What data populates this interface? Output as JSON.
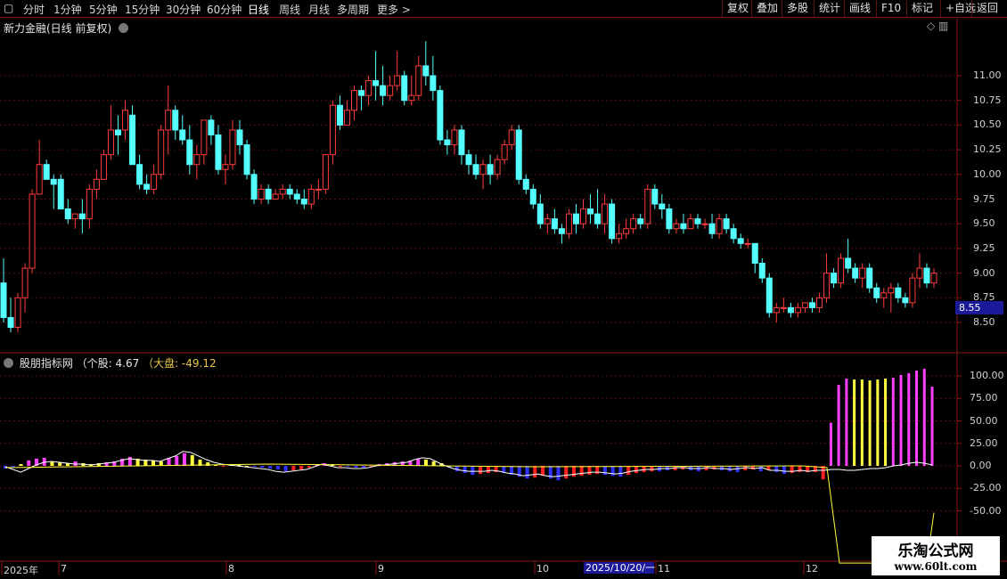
{
  "toolbar": {
    "periods": [
      "分时",
      "1分钟",
      "5分钟",
      "15分钟",
      "30分钟",
      "60分钟",
      "日线",
      "周线",
      "月线",
      "多周期",
      "更多 >"
    ],
    "active": "日线",
    "right": [
      "复权",
      "叠加",
      "多股",
      "统计",
      "画线",
      "F10",
      "标记",
      "+自选",
      "返回"
    ]
  },
  "main": {
    "title": "新力金融(日线 前复权)",
    "last_price": "8.55",
    "yticks": [
      "11.00",
      "10.75",
      "10.50",
      "10.25",
      "10.00",
      "9.75",
      "9.50",
      "9.25",
      "9.00",
      "8.75",
      "8.50"
    ]
  },
  "indicator": {
    "name": "股朋指标网",
    "stock_label": "（个股: 4.67",
    "market_label": "（大盘: -49.12",
    "yticks": [
      "100.00",
      "75.00",
      "50.00",
      "25.00",
      "0.00",
      "-25.00",
      "-50.00"
    ]
  },
  "xaxis": {
    "labels": [
      "2025年",
      "7",
      "8",
      "9",
      "10",
      "11",
      "12"
    ],
    "cursor_date": "2025/10/20/一"
  },
  "watermark": {
    "line1": "乐淘公式网",
    "line2": "www.60lt.com"
  },
  "colors": {
    "up": "#ff3c3c",
    "down": "#54ffff",
    "magenta": "#ff40ff",
    "yellow": "#ffff40",
    "blue": "#3030ff",
    "red": "#ff2020"
  },
  "chart_data": [
    {
      "type": "candlestick",
      "title": "新力金融(日线 前复权)",
      "ylim": [
        8.4,
        11.3
      ],
      "ohlc": [
        [
          8.9,
          9.15,
          8.5,
          8.55
        ],
        [
          8.55,
          8.75,
          8.4,
          8.45
        ],
        [
          8.45,
          8.8,
          8.4,
          8.75
        ],
        [
          8.75,
          9.1,
          8.6,
          9.05
        ],
        [
          9.05,
          9.85,
          9.0,
          9.8
        ],
        [
          9.8,
          10.35,
          9.8,
          10.1
        ],
        [
          10.1,
          10.15,
          9.95,
          9.95
        ],
        [
          9.95,
          10.0,
          9.65,
          9.9
        ],
        [
          9.95,
          10.0,
          9.65,
          9.65
        ],
        [
          9.65,
          9.75,
          9.5,
          9.55
        ],
        [
          9.55,
          9.6,
          9.45,
          9.6
        ],
        [
          9.6,
          9.75,
          9.4,
          9.55
        ],
        [
          9.55,
          9.9,
          9.45,
          9.85
        ],
        [
          9.85,
          10.05,
          9.75,
          9.95
        ],
        [
          9.95,
          10.25,
          9.95,
          10.2
        ],
        [
          10.2,
          10.7,
          10.15,
          10.45
        ],
        [
          10.45,
          10.6,
          10.2,
          10.4
        ],
        [
          10.45,
          10.75,
          10.35,
          10.65
        ],
        [
          10.6,
          10.7,
          10.1,
          10.1
        ],
        [
          10.1,
          10.2,
          9.85,
          9.9
        ],
        [
          9.9,
          10.0,
          9.8,
          9.85
        ],
        [
          9.85,
          10.1,
          9.8,
          10.0
        ],
        [
          10.0,
          10.5,
          9.95,
          10.45
        ],
        [
          10.45,
          10.9,
          10.2,
          10.65
        ],
        [
          10.65,
          10.7,
          10.35,
          10.45
        ],
        [
          10.45,
          10.6,
          10.3,
          10.35
        ],
        [
          10.35,
          10.5,
          10.0,
          10.1
        ],
        [
          10.1,
          10.3,
          9.95,
          10.2
        ],
        [
          10.2,
          10.55,
          10.1,
          10.55
        ],
        [
          10.55,
          10.6,
          10.3,
          10.4
        ],
        [
          10.4,
          10.5,
          10.0,
          10.05
        ],
        [
          10.05,
          10.2,
          9.9,
          10.1
        ],
        [
          10.1,
          10.55,
          10.05,
          10.45
        ],
        [
          10.45,
          10.55,
          10.2,
          10.3
        ],
        [
          10.3,
          10.35,
          9.95,
          10.0
        ],
        [
          10.0,
          10.05,
          9.7,
          9.75
        ],
        [
          9.75,
          9.9,
          9.7,
          9.85
        ],
        [
          9.85,
          9.9,
          9.7,
          9.75
        ],
        [
          9.75,
          9.85,
          9.75,
          9.8
        ],
        [
          9.8,
          9.9,
          9.75,
          9.85
        ],
        [
          9.85,
          9.9,
          9.75,
          9.8
        ],
        [
          9.8,
          9.85,
          9.7,
          9.75
        ],
        [
          9.75,
          9.85,
          9.65,
          9.7
        ],
        [
          9.7,
          9.9,
          9.65,
          9.85
        ],
        [
          9.85,
          9.95,
          9.75,
          9.85
        ],
        [
          9.85,
          10.2,
          9.8,
          10.2
        ],
        [
          10.2,
          10.75,
          10.1,
          10.7
        ],
        [
          10.7,
          10.8,
          10.45,
          10.5
        ],
        [
          10.5,
          10.75,
          10.5,
          10.65
        ],
        [
          10.65,
          10.9,
          10.55,
          10.85
        ],
        [
          10.85,
          10.9,
          10.65,
          10.8
        ],
        [
          10.8,
          11.0,
          10.7,
          10.95
        ],
        [
          10.95,
          11.25,
          10.75,
          10.9
        ],
        [
          10.9,
          11.1,
          10.7,
          10.8
        ],
        [
          10.8,
          11.0,
          10.75,
          10.9
        ],
        [
          10.9,
          11.25,
          10.85,
          11.0
        ],
        [
          11.0,
          11.05,
          10.7,
          10.75
        ],
        [
          10.75,
          11.0,
          10.7,
          10.8
        ],
        [
          10.8,
          11.2,
          10.75,
          11.1
        ],
        [
          11.1,
          11.35,
          10.9,
          11.0
        ],
        [
          11.0,
          11.2,
          10.75,
          10.85
        ],
        [
          10.85,
          10.9,
          10.3,
          10.35
        ],
        [
          10.35,
          10.45,
          10.2,
          10.3
        ],
        [
          10.3,
          10.5,
          10.2,
          10.45
        ],
        [
          10.45,
          10.5,
          10.1,
          10.2
        ],
        [
          10.2,
          10.25,
          10.0,
          10.1
        ],
        [
          10.1,
          10.2,
          9.95,
          10.0
        ],
        [
          10.0,
          10.15,
          9.85,
          10.1
        ],
        [
          10.1,
          10.2,
          9.9,
          10.0
        ],
        [
          10.0,
          10.2,
          9.95,
          10.15
        ],
        [
          10.15,
          10.35,
          10.1,
          10.3
        ],
        [
          10.3,
          10.5,
          10.25,
          10.45
        ],
        [
          10.45,
          10.5,
          9.9,
          9.95
        ],
        [
          9.95,
          10.0,
          9.8,
          9.85
        ],
        [
          9.85,
          9.9,
          9.65,
          9.7
        ],
        [
          9.7,
          9.8,
          9.45,
          9.5
        ],
        [
          9.5,
          9.6,
          9.4,
          9.55
        ],
        [
          9.55,
          9.65,
          9.4,
          9.45
        ],
        [
          9.45,
          9.5,
          9.3,
          9.4
        ],
        [
          9.4,
          9.65,
          9.35,
          9.6
        ],
        [
          9.6,
          9.7,
          9.4,
          9.5
        ],
        [
          9.5,
          9.75,
          9.45,
          9.65
        ],
        [
          9.65,
          9.8,
          9.5,
          9.6
        ],
        [
          9.6,
          9.85,
          9.45,
          9.5
        ],
        [
          9.5,
          9.8,
          9.4,
          9.7
        ],
        [
          9.7,
          9.75,
          9.3,
          9.35
        ],
        [
          9.35,
          9.5,
          9.3,
          9.4
        ],
        [
          9.4,
          9.55,
          9.35,
          9.45
        ],
        [
          9.45,
          9.6,
          9.4,
          9.55
        ],
        [
          9.55,
          9.6,
          9.45,
          9.5
        ],
        [
          9.5,
          9.9,
          9.45,
          9.85
        ],
        [
          9.85,
          9.9,
          9.65,
          9.7
        ],
        [
          9.7,
          9.8,
          9.55,
          9.65
        ],
        [
          9.65,
          9.7,
          9.4,
          9.45
        ],
        [
          9.45,
          9.55,
          9.4,
          9.5
        ],
        [
          9.5,
          9.6,
          9.4,
          9.45
        ],
        [
          9.45,
          9.6,
          9.45,
          9.55
        ],
        [
          9.55,
          9.6,
          9.45,
          9.5
        ],
        [
          9.5,
          9.55,
          9.45,
          9.5
        ],
        [
          9.5,
          9.6,
          9.35,
          9.4
        ],
        [
          9.4,
          9.6,
          9.35,
          9.55
        ],
        [
          9.55,
          9.6,
          9.4,
          9.45
        ],
        [
          9.45,
          9.5,
          9.3,
          9.35
        ],
        [
          9.35,
          9.4,
          9.25,
          9.3
        ],
        [
          9.3,
          9.35,
          9.25,
          9.3
        ],
        [
          9.3,
          9.3,
          9.0,
          9.1
        ],
        [
          9.1,
          9.15,
          8.9,
          8.95
        ],
        [
          8.95,
          9.0,
          8.55,
          8.6
        ],
        [
          8.6,
          8.7,
          8.5,
          8.65
        ],
        [
          8.65,
          8.75,
          8.6,
          8.65
        ],
        [
          8.65,
          8.7,
          8.55,
          8.6
        ],
        [
          8.6,
          8.7,
          8.55,
          8.65
        ],
        [
          8.65,
          8.7,
          8.6,
          8.7
        ],
        [
          8.7,
          8.75,
          8.6,
          8.65
        ],
        [
          8.65,
          8.8,
          8.6,
          8.75
        ],
        [
          8.75,
          9.2,
          8.7,
          9.0
        ],
        [
          9.0,
          9.05,
          8.85,
          8.9
        ],
        [
          8.9,
          9.2,
          8.85,
          9.15
        ],
        [
          9.15,
          9.35,
          9.0,
          9.05
        ],
        [
          9.05,
          9.1,
          8.9,
          8.95
        ],
        [
          8.95,
          9.1,
          8.85,
          9.05
        ],
        [
          9.05,
          9.1,
          8.8,
          8.85
        ],
        [
          8.85,
          8.9,
          8.7,
          8.75
        ],
        [
          8.75,
          8.85,
          8.65,
          8.8
        ],
        [
          8.8,
          8.9,
          8.6,
          8.85
        ],
        [
          8.85,
          8.9,
          8.7,
          8.75
        ],
        [
          8.75,
          8.8,
          8.65,
          8.7
        ],
        [
          8.7,
          9.0,
          8.65,
          8.95
        ],
        [
          8.95,
          9.2,
          8.85,
          9.05
        ],
        [
          9.05,
          9.1,
          8.85,
          8.9
        ],
        [
          8.9,
          9.05,
          8.85,
          9.0
        ]
      ]
    },
    {
      "type": "bar",
      "title": "股朋指标网",
      "ylim": [
        -60,
        110
      ],
      "values": [
        -3,
        -2,
        2,
        6,
        8,
        9,
        5,
        4,
        3,
        5,
        3,
        2,
        3,
        4,
        5,
        8,
        10,
        8,
        7,
        6,
        5,
        9,
        11,
        14,
        12,
        7,
        4,
        1,
        -1,
        2,
        1,
        0,
        -1,
        -2,
        -3,
        -4,
        -6,
        -5,
        -4,
        -2,
        1,
        3,
        2,
        -1,
        -1,
        -2,
        -2,
        -1,
        2,
        3,
        4,
        5,
        6,
        8,
        7,
        5,
        3,
        -2,
        -6,
        -8,
        -10,
        -9,
        -8,
        -7,
        -8,
        -10,
        -12,
        -14,
        -13,
        -11,
        -14,
        -16,
        -14,
        -12,
        -11,
        -10,
        -9,
        -10,
        -11,
        -12,
        -10,
        -8,
        -7,
        -6,
        -6,
        -5,
        -5,
        -4,
        -5,
        -6,
        -5,
        -4,
        -5,
        -6,
        -7,
        -5,
        -4,
        -6,
        -5,
        -7,
        -9,
        -8,
        -7,
        -7,
        -7,
        -15,
        48,
        90,
        97,
        96,
        96,
        95,
        96,
        97,
        98,
        101,
        103,
        106,
        108,
        88
      ],
      "value_colors": [
        "blue",
        "blue",
        "yellow",
        "magenta",
        "magenta",
        "magenta",
        "yellow",
        "yellow",
        "yellow",
        "magenta",
        "yellow",
        "yellow",
        "yellow",
        "magenta",
        "magenta",
        "magenta",
        "magenta",
        "yellow",
        "yellow",
        "yellow",
        "yellow",
        "magenta",
        "magenta",
        "magenta",
        "yellow",
        "yellow",
        "yellow",
        "yellow",
        "red",
        "yellow",
        "yellow",
        "yellow",
        "blue",
        "blue",
        "blue",
        "blue",
        "blue",
        "red",
        "red",
        "red",
        "magenta",
        "magenta",
        "yellow",
        "red",
        "blue",
        "blue",
        "blue",
        "red",
        "magenta",
        "magenta",
        "magenta",
        "magenta",
        "magenta",
        "magenta",
        "yellow",
        "yellow",
        "yellow",
        "blue",
        "blue",
        "blue",
        "blue",
        "red",
        "red",
        "red",
        "blue",
        "blue",
        "blue",
        "blue",
        "red",
        "red",
        "blue",
        "blue",
        "red",
        "red",
        "red",
        "red",
        "red",
        "blue",
        "blue",
        "blue",
        "red",
        "red",
        "red",
        "red",
        "blue",
        "blue",
        "red",
        "red",
        "blue",
        "blue",
        "red",
        "red",
        "blue",
        "blue",
        "blue",
        "red",
        "red",
        "blue",
        "red",
        "blue",
        "blue",
        "red",
        "red",
        "red",
        "red",
        "red",
        "magenta",
        "magenta",
        "magenta",
        "yellow",
        "yellow",
        "yellow",
        "yellow",
        "yellow",
        "magenta",
        "magenta",
        "magenta",
        "magenta",
        "magenta",
        "magenta",
        "yellow"
      ],
      "series": [
        {
          "name": "个股",
          "values": [
            4.67
          ]
        },
        {
          "name": "大盘",
          "values": [
            -49.12
          ]
        }
      ]
    }
  ]
}
